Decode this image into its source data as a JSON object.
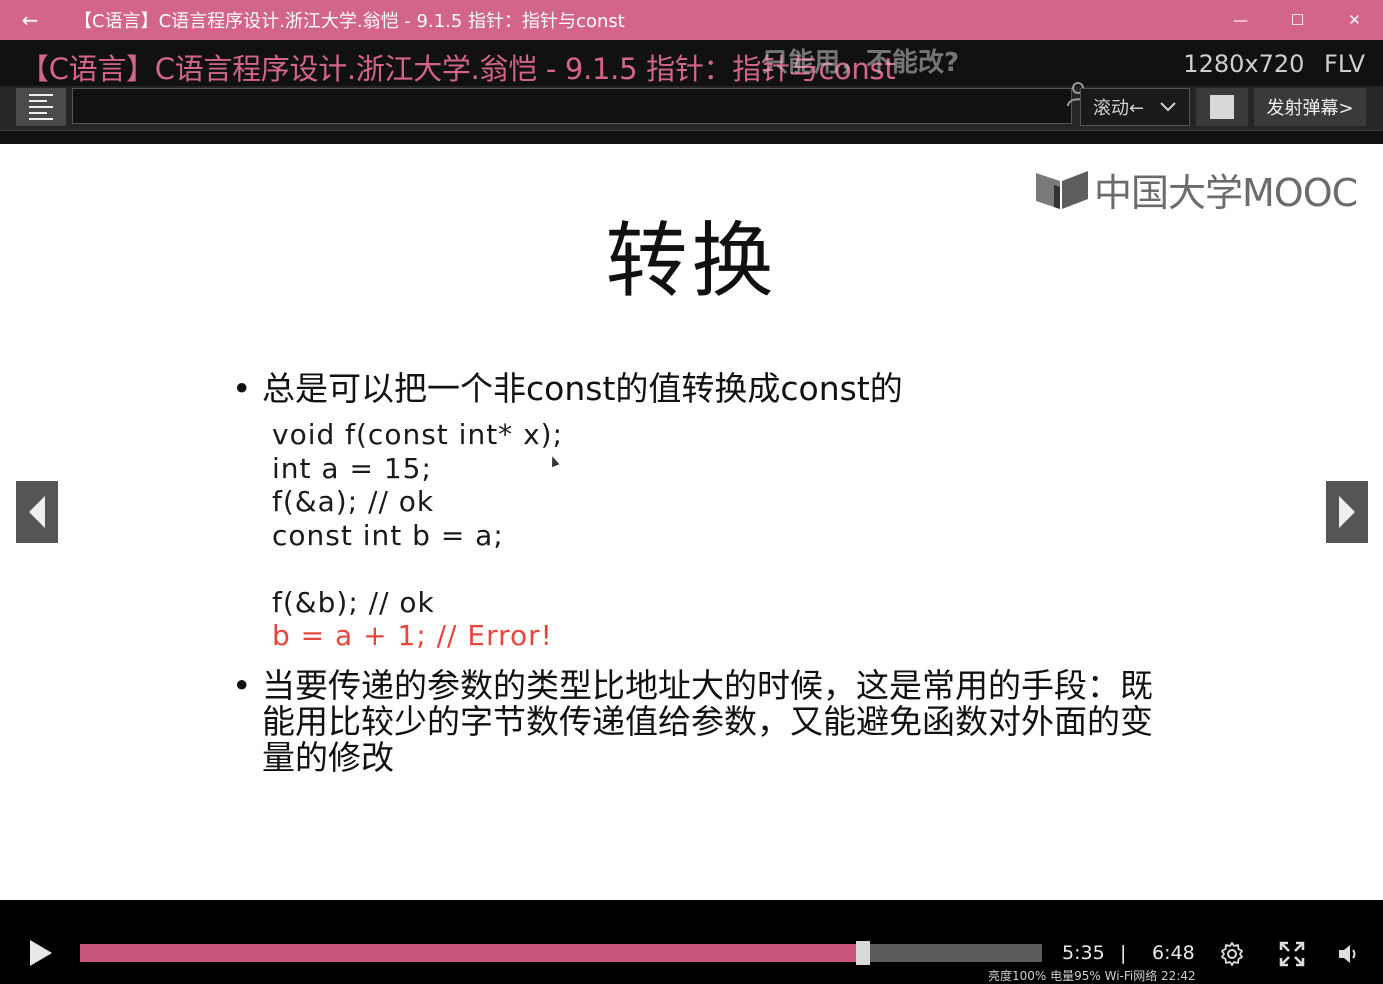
{
  "window": {
    "title": "【C语言】C语言程序设计.浙江大学.翁恺 - 9.1.5 指针：指针与const",
    "back_icon": "←",
    "minimize_icon": "—",
    "maximize_icon": "☐",
    "close_icon": "✕"
  },
  "player_header": {
    "video_title": "【C语言】C语言程序设计.浙江大学.翁恺 - 9.1.5 指针：指针与const",
    "floating_danmaku": "只能用，不能改?",
    "resolution": "1280x720",
    "format": "FLV",
    "danmaku_input_value": "",
    "scroll_mode_label": "滚动←",
    "send_button_label": "发射弹幕>"
  },
  "slide": {
    "logo_text": "中国大学MOOC",
    "title": "转换",
    "bullet1": "总是可以把一个非const的值转换成const的",
    "code_lines": [
      "void f(const int* x);",
      "int a = 15;",
      "f(&a); // ok",
      "const int b = a;",
      "",
      "f(&b); // ok"
    ],
    "code_error_line": "b = a + 1; // Error!",
    "bullet2": "当要传递的参数的类型比地址大的时候，这是常用的手段：既能用比较少的字节数传递值给参数，又能避免函数对外面的变量的修改",
    "bullet_mark": "•"
  },
  "controls": {
    "current_time": "5:35",
    "separator": "|",
    "duration": "6:48",
    "progress_fraction": 0.8137,
    "status_text": "亮度100% 电量95% Wi-Fi网络 22:42"
  },
  "colors": {
    "accent_pink": "#d3658a",
    "error_red": "#e8463a"
  }
}
